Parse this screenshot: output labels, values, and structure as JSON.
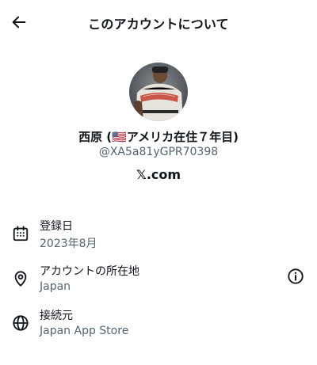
{
  "header": {
    "title": "このアカウントについて",
    "back_icon": "arrow-left-icon"
  },
  "profile": {
    "display_name": "西原 (🇺🇸アメリカ在住７年目)",
    "handle": "@XA5a81yGPR70398",
    "site_logo_mark": "𝕏",
    "site_logo_text": ".com"
  },
  "details": [
    {
      "icon": "calendar-icon",
      "label": "登録日",
      "value": "2023年8月"
    },
    {
      "icon": "location-pin-icon",
      "label": "アカウントの所在地",
      "value": "Japan",
      "info_icon": "info-icon"
    },
    {
      "icon": "globe-icon",
      "label": "接続元",
      "value": "Japan App Store"
    }
  ],
  "colors": {
    "text_primary": "#0f1419",
    "text_secondary": "#536471",
    "background": "#ffffff"
  }
}
